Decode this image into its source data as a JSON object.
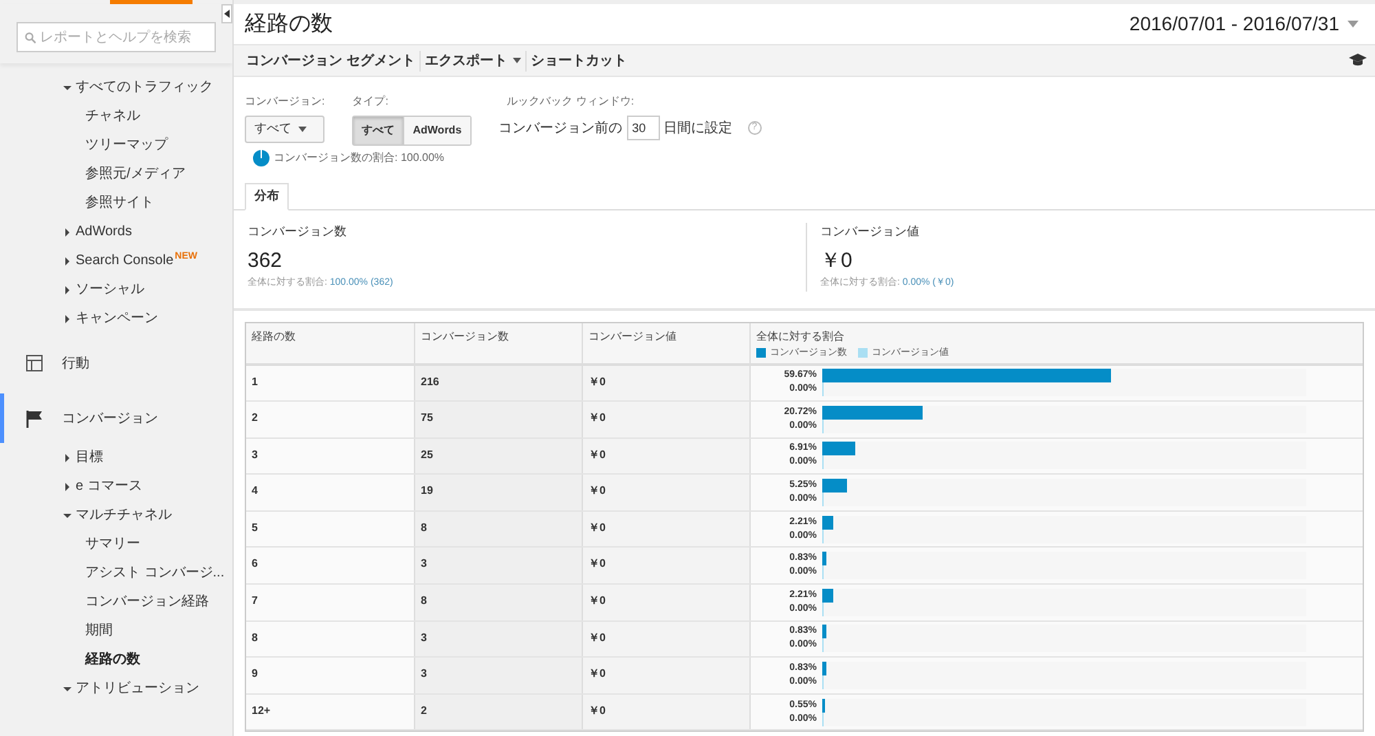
{
  "search": {
    "placeholder": "レポートとヘルプを検索"
  },
  "sidebar": {
    "items": [
      {
        "label": "すべてのトラフィック",
        "expanded": true,
        "children": [
          {
            "label": "チャネル",
            "selected": false
          },
          {
            "label": "ツリーマップ",
            "selected": false
          },
          {
            "label": "参照元/メディア",
            "selected": false
          },
          {
            "label": "参照サイト",
            "selected": false
          }
        ]
      },
      {
        "label": "AdWords",
        "expanded": false
      },
      {
        "label": "Search Console",
        "badge": "NEW",
        "expanded": false
      },
      {
        "label": "ソーシャル",
        "expanded": false
      },
      {
        "label": "キャンペーン",
        "expanded": false
      }
    ],
    "sections": [
      {
        "label": "行動",
        "kind": "layout",
        "selected": false
      },
      {
        "label": "コンバージョン",
        "kind": "flag",
        "selected": true,
        "items": [
          {
            "label": "目標",
            "expanded": false
          },
          {
            "label": "e コマース",
            "expanded": false
          },
          {
            "label": "マルチチャネル",
            "expanded": true,
            "children": [
              {
                "label": "サマリー",
                "selected": false
              },
              {
                "label": "アシスト コンバージ...",
                "selected": false
              },
              {
                "label": "コンバージョン経路",
                "selected": false
              },
              {
                "label": "期間",
                "selected": false
              },
              {
                "label": "経路の数",
                "selected": true
              }
            ]
          },
          {
            "label": "アトリビューション",
            "expanded": true
          }
        ]
      }
    ]
  },
  "title": "経路の数",
  "date_range": "2016/07/01 - 2016/07/31",
  "toolbar": [
    {
      "label": "コンバージョン セグメント",
      "dropdown": false
    },
    {
      "label": "エクスポート",
      "dropdown": true
    },
    {
      "label": "ショートカット",
      "dropdown": false
    }
  ],
  "filters": {
    "conversion": {
      "label": "コンバージョン:",
      "value": "すべて"
    },
    "type": {
      "label": "タイプ:",
      "options": [
        {
          "label": "すべて",
          "selected": true
        },
        {
          "label": "AdWords",
          "selected": false
        }
      ]
    },
    "lookback": {
      "label": "ルックバック ウィンドウ:",
      "before": "コンバージョン前の",
      "value": "30",
      "after": "日間に設定",
      "help": "?"
    },
    "sample": "コンバージョン数の割合: 100.00%"
  },
  "tabs": [
    {
      "label": "分布",
      "selected": true
    }
  ],
  "scorecards": [
    {
      "label": "コンバージョン数",
      "value": "362",
      "note_prefix": "全体に対する割合: ",
      "note": "100.00% (362)"
    },
    {
      "label": "コンバージョン値",
      "value": "￥0",
      "note_prefix": "全体に対する割合: ",
      "note": "0.00% (￥0)"
    }
  ],
  "table": {
    "columns": [
      "経路の数",
      "コンバージョン数",
      "コンバージョン値",
      "全体に対する割合"
    ],
    "legend": [
      {
        "label": "コンバージョン数",
        "color": "#058dc7"
      },
      {
        "label": "コンバージョン値",
        "color": "#aadff3"
      }
    ],
    "rows": [
      {
        "paths": "1",
        "conversions": "216",
        "value": "￥0",
        "bars": [
          {
            "share": "59.67%",
            "level": 0.5967
          },
          {
            "share": "0.00%",
            "level": 0
          }
        ]
      },
      {
        "paths": "2",
        "conversions": "75",
        "value": "￥0",
        "bars": [
          {
            "share": "20.72%",
            "level": 0.2072
          },
          {
            "share": "0.00%",
            "level": 0
          }
        ]
      },
      {
        "paths": "3",
        "conversions": "25",
        "value": "￥0",
        "bars": [
          {
            "share": "6.91%",
            "level": 0.0691
          },
          {
            "share": "0.00%",
            "level": 0
          }
        ]
      },
      {
        "paths": "4",
        "conversions": "19",
        "value": "￥0",
        "bars": [
          {
            "share": "5.25%",
            "level": 0.0525
          },
          {
            "share": "0.00%",
            "level": 0
          }
        ]
      },
      {
        "paths": "5",
        "conversions": "8",
        "value": "￥0",
        "bars": [
          {
            "share": "2.21%",
            "level": 0.0221
          },
          {
            "share": "0.00%",
            "level": 0
          }
        ]
      },
      {
        "paths": "6",
        "conversions": "3",
        "value": "￥0",
        "bars": [
          {
            "share": "0.83%",
            "level": 0.0083
          },
          {
            "share": "0.00%",
            "level": 0
          }
        ]
      },
      {
        "paths": "7",
        "conversions": "8",
        "value": "￥0",
        "bars": [
          {
            "share": "2.21%",
            "level": 0.0221
          },
          {
            "share": "0.00%",
            "level": 0
          }
        ]
      },
      {
        "paths": "8",
        "conversions": "3",
        "value": "￥0",
        "bars": [
          {
            "share": "0.83%",
            "level": 0.0083
          },
          {
            "share": "0.00%",
            "level": 0
          }
        ]
      },
      {
        "paths": "9",
        "conversions": "3",
        "value": "￥0",
        "bars": [
          {
            "share": "0.83%",
            "level": 0.0083
          },
          {
            "share": "0.00%",
            "level": 0
          }
        ]
      },
      {
        "paths": "12+",
        "conversions": "2",
        "value": "￥0",
        "bars": [
          {
            "share": "0.55%",
            "level": 0.0055
          },
          {
            "share": "0.00%",
            "level": 0
          }
        ]
      }
    ]
  }
}
